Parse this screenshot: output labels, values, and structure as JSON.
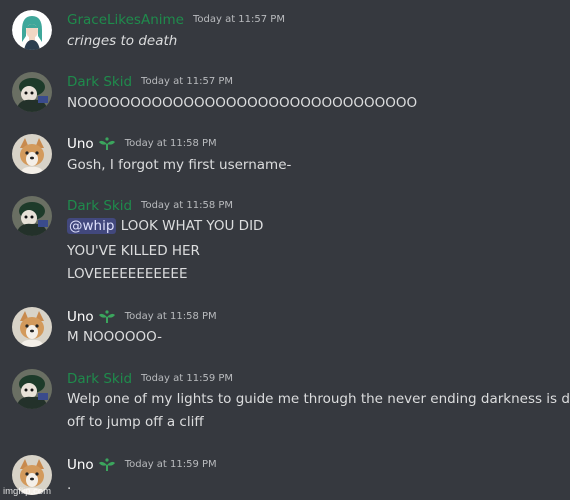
{
  "colors": {
    "background": "#36393f",
    "grace_name": "#1f8b4c",
    "dark_skid_name": "#1f8b4c",
    "uno_name": "#ffffff",
    "bot_icon": "#3ba55d",
    "mention_bg": "#414675"
  },
  "messages": [
    {
      "username": "GraceLikesAnime",
      "timestamp": "Today at 11:57 PM",
      "avatar_icon": "anime-girl-avatar-icon",
      "lines": [
        "cringes to death"
      ]
    },
    {
      "username": "Dark Skid",
      "timestamp": "Today at 11:57 PM",
      "avatar_icon": "dark-skid-avatar-icon",
      "lines": [
        "NOOOOOOOOOOOOOOOOOOOOOOOOOOOOOOOO"
      ]
    },
    {
      "username": "Uno",
      "timestamp": "Today at 11:58 PM",
      "avatar_icon": "corgi-avatar-icon",
      "badge_icon": "sprout-icon",
      "lines": [
        "Gosh, I forgot my first username-"
      ]
    },
    {
      "username": "Dark Skid",
      "timestamp": "Today at 11:58 PM",
      "avatar_icon": "dark-skid-avatar-icon",
      "mention": "@whip",
      "lines": [
        "LOOK WHAT YOU DID",
        "YOU'VE KILLED HER",
        "LOVEEEEEEEEEEE"
      ]
    },
    {
      "username": "Uno",
      "timestamp": "Today at 11:58 PM",
      "avatar_icon": "corgi-avatar-icon",
      "badge_icon": "sprout-icon",
      "lines": [
        "M NOOOOOO-"
      ]
    },
    {
      "username": "Dark Skid",
      "timestamp": "Today at 11:59 PM",
      "avatar_icon": "dark-skid-avatar-icon",
      "lines": [
        "Welp one of my lights to guide me through the never ending darkness is dead",
        "off to jump off a cliff"
      ]
    },
    {
      "username": "Uno",
      "timestamp": "Today at 11:59 PM",
      "avatar_icon": "corgi-avatar-icon",
      "badge_icon": "sprout-icon",
      "lines": [
        "."
      ]
    }
  ],
  "watermark": "imgflip.com"
}
